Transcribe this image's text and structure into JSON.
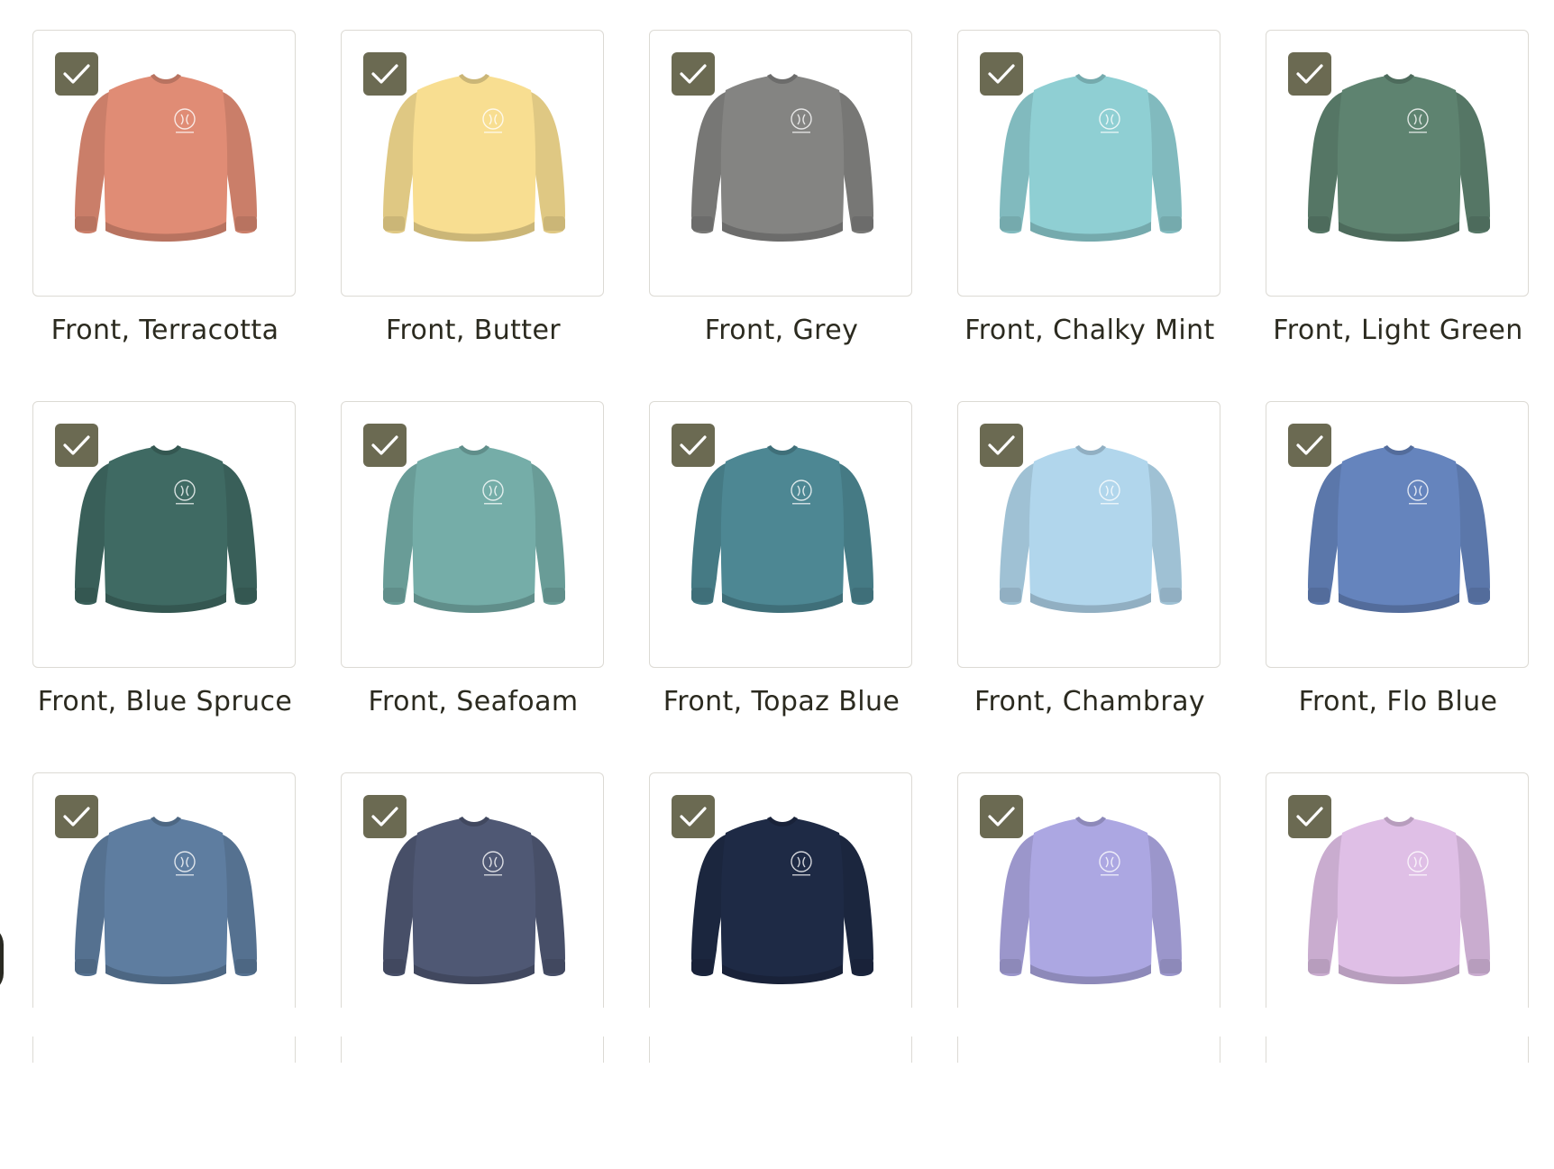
{
  "variants": [
    {
      "label": "Front, Terracotta",
      "color": "#e08c75",
      "selected": true
    },
    {
      "label": "Front, Butter",
      "color": "#f8de91",
      "selected": true
    },
    {
      "label": "Front, Grey",
      "color": "#848482",
      "selected": true
    },
    {
      "label": "Front, Chalky Mint",
      "color": "#8fcfd3",
      "selected": true
    },
    {
      "label": "Front, Light Green",
      "color": "#5e8370",
      "selected": true
    },
    {
      "label": "Front, Blue Spruce",
      "color": "#3f6a63",
      "selected": true
    },
    {
      "label": "Front, Seafoam",
      "color": "#75ada8",
      "selected": true
    },
    {
      "label": "Front, Topaz Blue",
      "color": "#4d8793",
      "selected": true
    },
    {
      "label": "Front, Chambray",
      "color": "#b1d6ec",
      "selected": true
    },
    {
      "label": "Front, Flo Blue",
      "color": "#6584bd",
      "selected": true
    },
    {
      "label": "",
      "color": "#5e7da0",
      "selected": true
    },
    {
      "label": "",
      "color": "#4f5874",
      "selected": true
    },
    {
      "label": "",
      "color": "#1e2a45",
      "selected": true
    },
    {
      "label": "",
      "color": "#aca7e2",
      "selected": true
    },
    {
      "label": "",
      "color": "#dfbfe6",
      "selected": true
    }
  ],
  "colors": {
    "check_bg": "#6b6a52",
    "card_border": "#dcdad4",
    "label_text": "#2b2a1f"
  },
  "icons": {
    "selected": "checkmark-icon",
    "product": "sweatshirt-icon"
  }
}
